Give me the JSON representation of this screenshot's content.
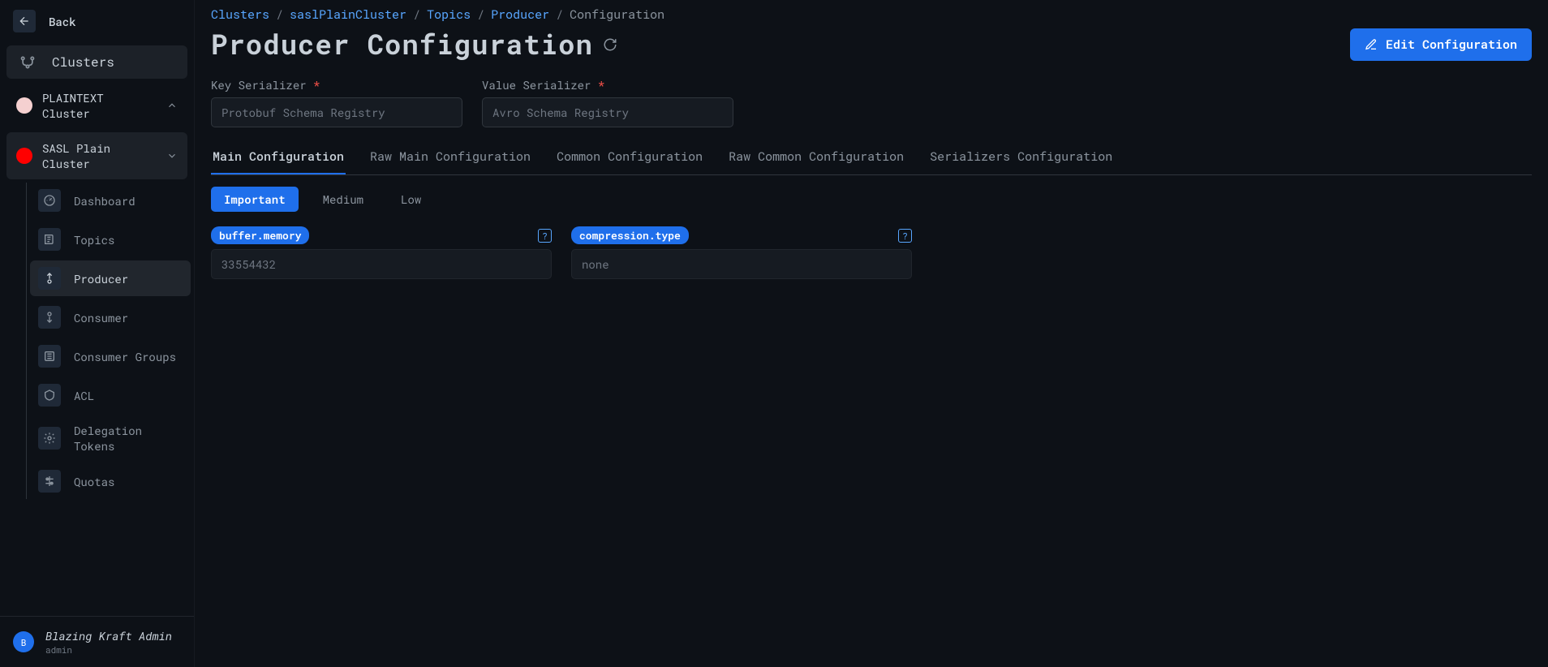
{
  "sidebar": {
    "back_label": "Back",
    "clusters_label": "Clusters",
    "clusters_list": [
      {
        "name": "PLAINTEXT Cluster",
        "color": "#f5d0d0"
      },
      {
        "name": "SASL Plain Cluster",
        "color": "#ff0000"
      }
    ],
    "nav_items": [
      {
        "label": "Dashboard"
      },
      {
        "label": "Topics"
      },
      {
        "label": "Producer"
      },
      {
        "label": "Consumer"
      },
      {
        "label": "Consumer Groups"
      },
      {
        "label": "ACL"
      },
      {
        "label": "Delegation Tokens"
      },
      {
        "label": "Quotas"
      }
    ],
    "footer": {
      "avatar": "B",
      "name": "Blazing Kraft Admin",
      "role": "admin"
    }
  },
  "breadcrumb": [
    {
      "label": "Clusters",
      "link": true
    },
    {
      "label": "saslPlainCluster",
      "link": true
    },
    {
      "label": "Topics",
      "link": true
    },
    {
      "label": "Producer",
      "link": true
    },
    {
      "label": "Configuration",
      "link": false
    }
  ],
  "page": {
    "title": "Producer Configuration",
    "edit_button": "Edit Configuration"
  },
  "serializers": {
    "key_label": "Key Serializer",
    "key_value": "Protobuf Schema Registry",
    "value_label": "Value Serializer",
    "value_value": "Avro Schema Registry"
  },
  "tabs": [
    "Main Configuration",
    "Raw Main Configuration",
    "Common Configuration",
    "Raw Common Configuration",
    "Serializers Configuration"
  ],
  "filters": [
    "Important",
    "Medium",
    "Low"
  ],
  "configs": [
    {
      "name": "buffer.memory",
      "value": "33554432"
    },
    {
      "name": "compression.type",
      "value": "none"
    }
  ]
}
